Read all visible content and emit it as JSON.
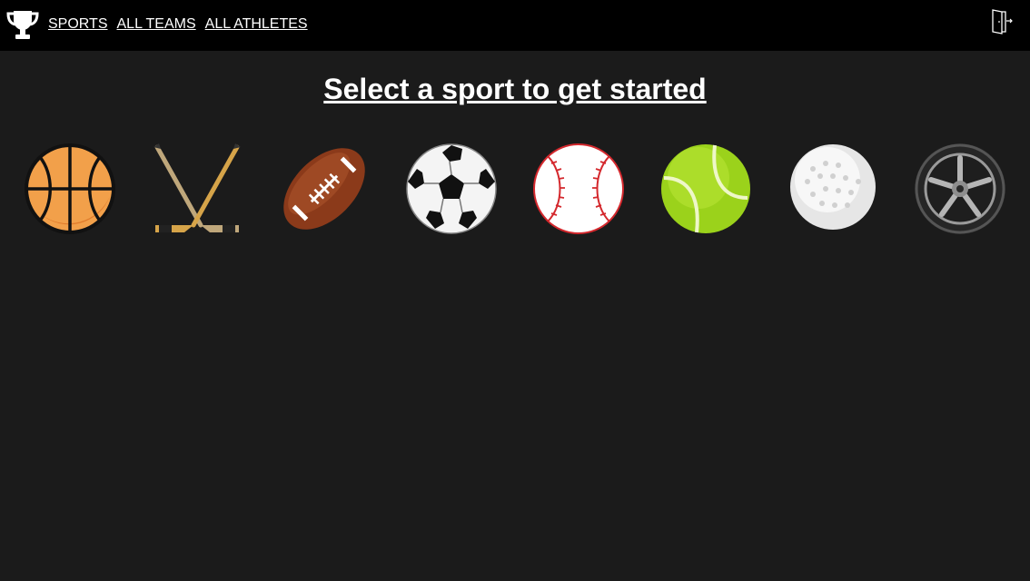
{
  "nav": {
    "links": [
      {
        "label": "SPORTS"
      },
      {
        "label": "ALL TEAMS"
      },
      {
        "label": "ALL ATHLETES"
      }
    ]
  },
  "icons": {
    "logo": "trophy-icon",
    "logout": "door-exit-icon"
  },
  "main": {
    "headline": "Select a sport to get started"
  },
  "sports": [
    {
      "icon": "basketball-icon"
    },
    {
      "icon": "hockey-sticks-icon"
    },
    {
      "icon": "football-icon"
    },
    {
      "icon": "soccer-ball-icon"
    },
    {
      "icon": "baseball-icon"
    },
    {
      "icon": "tennis-ball-icon"
    },
    {
      "icon": "golf-ball-icon"
    },
    {
      "icon": "racing-wheel-icon"
    }
  ],
  "colors": {
    "topbar": "#000000",
    "background": "#1b1b1b",
    "text": "#ffffff"
  }
}
